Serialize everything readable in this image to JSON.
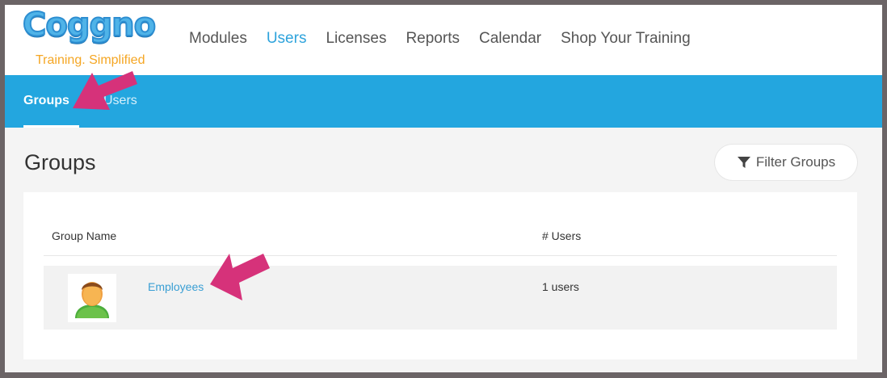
{
  "logo": {
    "word": "Coggno",
    "tagline": "Training. Simplified"
  },
  "nav": {
    "items": [
      {
        "label": "Modules",
        "active": false
      },
      {
        "label": "Users",
        "active": true
      },
      {
        "label": "Licenses",
        "active": false
      },
      {
        "label": "Reports",
        "active": false
      },
      {
        "label": "Calendar",
        "active": false
      },
      {
        "label": "Shop Your Training",
        "active": false
      }
    ]
  },
  "subnav": {
    "groups_label": "Groups",
    "users_label": "Users"
  },
  "page": {
    "title": "Groups",
    "filter_button": "Filter Groups"
  },
  "table": {
    "columns": [
      "Group Name",
      "# Users"
    ],
    "rows": [
      {
        "name": "Employees",
        "users": "1 users"
      }
    ]
  },
  "colors": {
    "accent": "#23a6df",
    "link": "#3a9fd4",
    "annotation_arrow": "#d6327a",
    "logo_orange": "#f5a623"
  },
  "icons": {
    "filter": "funnel-icon",
    "avatar": "user-avatar-icon",
    "annotation": "arrow-annotation-icon"
  }
}
